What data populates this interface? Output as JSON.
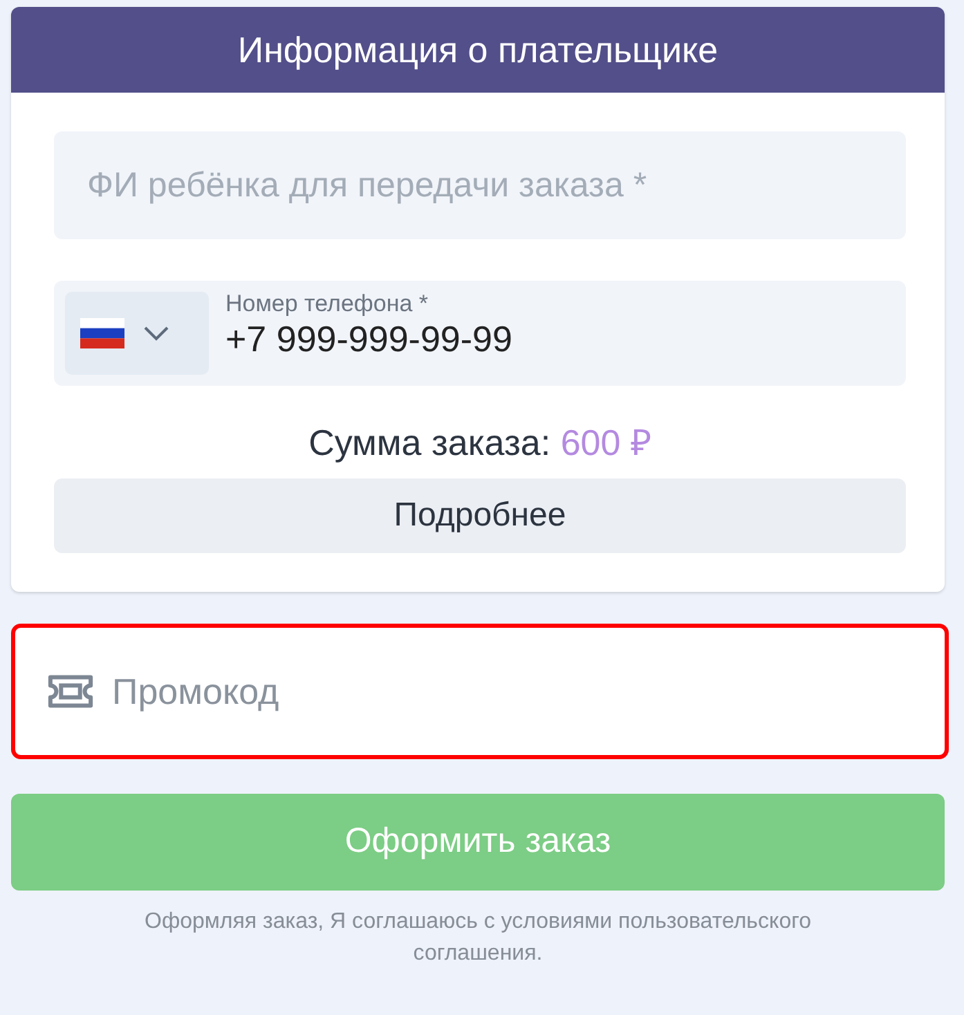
{
  "header": {
    "title": "Информация о плательщике"
  },
  "name_field": {
    "placeholder": "ФИ ребёнка для передачи заказа *"
  },
  "phone_field": {
    "label": "Номер телефона *",
    "value": "+7 999-999-99-99"
  },
  "order_sum": {
    "label": "Сумма заказа:",
    "amount": "600 ₽"
  },
  "details_button": "Подробнее",
  "promo_field": {
    "placeholder": "Промокод",
    "highlighted": true
  },
  "submit_button": "Оформить заказ",
  "agreement": "Оформляя заказ, Я соглашаюсь с условиями пользовательского соглашения."
}
